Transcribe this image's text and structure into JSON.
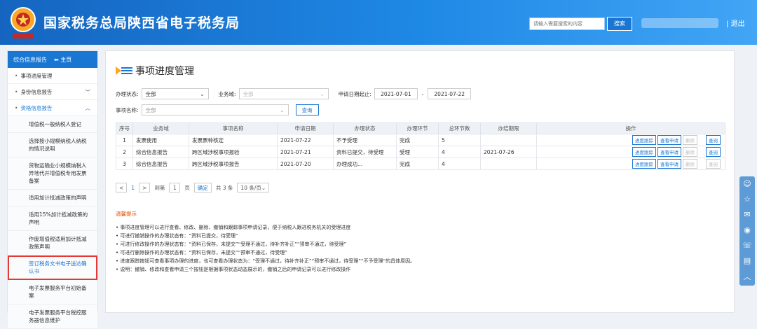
{
  "header": {
    "title": "国家税务总局陕西省电子税务局",
    "search_placeholder": "请输入需要搜索的内容",
    "search_button": "搜索",
    "logout": "| 退出"
  },
  "sidebar": {
    "top": {
      "label": "综合信息报告",
      "home": "主页"
    },
    "items": [
      {
        "label": "事项进度管理",
        "has_arrow": false
      },
      {
        "label": "身份信息报告",
        "has_arrow": true
      },
      {
        "label": "资格信息报告",
        "has_arrow": true,
        "active": true
      }
    ],
    "subitems": [
      "增值税一般纳税人登记",
      "选择按小规模纳税人纳税的情况说明",
      "货物运输业小规模纳税人异地代开增值税专用发票备案",
      "适用加计抵减政策的声明",
      "适用15%加计抵减政策的声明",
      "作废增值税适用加计抵减政策声明",
      "签订税务文书电子送达确认书",
      "电子发票服务平台初始备案",
      "电子发票服务平台税控服务器信息维护"
    ]
  },
  "main": {
    "title": "事项进度管理",
    "filters": {
      "status_label": "办理状态:",
      "status_value": "全部",
      "domain_label": "业务域:",
      "domain_value": "全部",
      "date_label": "申请日期起止:",
      "date_from": "2021-07-01",
      "date_sep": "-",
      "date_to": "2021-07-22",
      "name_label": "事项名称:",
      "name_value": "全部",
      "query_button": "查询"
    },
    "table": {
      "headers": [
        "序号",
        "业务域",
        "事项名称",
        "申请日期",
        "办理状态",
        "办理环节",
        "总环节数",
        "办结期限",
        "操作"
      ],
      "rows": [
        [
          "1",
          "发票使用",
          "发票票种核定",
          "2021-07-22",
          "不予受理",
          "完成",
          "5",
          ""
        ],
        [
          "2",
          "综合信息报告",
          "跨区域涉税事项报验",
          "2021-07-21",
          "资料已提交，待受理",
          "受理",
          "4",
          "2021-07-26"
        ],
        [
          "3",
          "综合信息报告",
          "跨区域涉税事项报告",
          "2021-07-20",
          "办理成功...",
          "完成",
          "4",
          ""
        ]
      ],
      "actions": [
        "进度跟踪",
        "查看申请",
        "删除",
        "查阅"
      ]
    },
    "pager": {
      "prev": "<",
      "page": "1",
      "next": ">",
      "goto_label": "到第",
      "goto_value": "1",
      "page_unit": "页",
      "confirm": "确定",
      "total": "共 3 条",
      "per_page": "10 条/页"
    },
    "tips_title": "温馨提示",
    "tips": [
      "事项进度管理可以进行查看、修改、删除、撤销和跟踪事项申请记录，便于纳税人跟进税务机关的受理进度",
      "可进行撤销操作的办理状态有：“资料已提交，待受理”",
      "可进行修改操作的办理状态有：“资料已保存，未提交”“受理不通过，待补齐补正”“预审不通过，待受理”",
      "可进行删除操作的办理状态有：“资料已保存，未提交”“预审不通过，待受理”",
      "进度跟踪按钮可查看事项办理的进度，也可查看办理状态为：“受理不通过，待补齐补正”“预审不通过，待受理”“不予受理”的具体原因。",
      "说明：撤销、修改和查看申请三个按钮是根据事项状态动态展示的，撤销之后的申请记录可以进行修改操作"
    ]
  }
}
